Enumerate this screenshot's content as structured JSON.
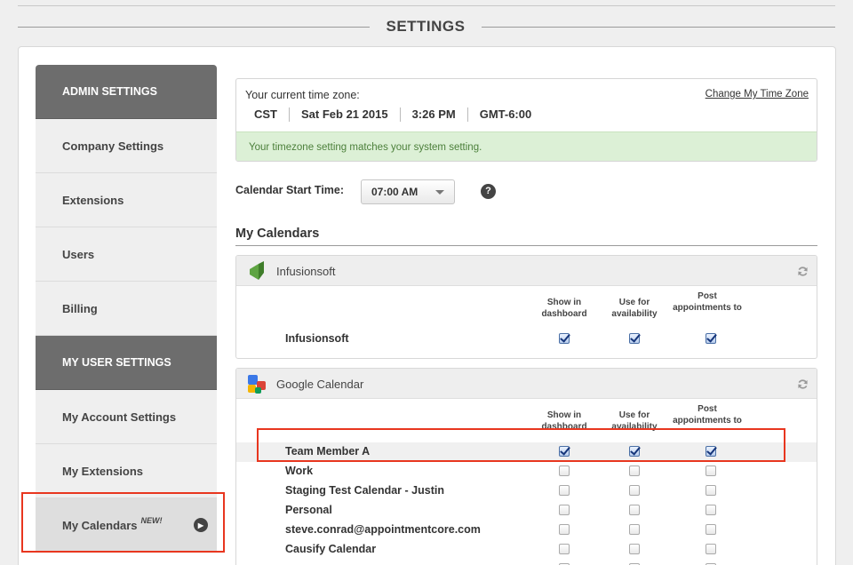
{
  "page": {
    "title": "SETTINGS"
  },
  "sidebar": {
    "items": [
      {
        "label": "ADMIN SETTINGS",
        "type": "header"
      },
      {
        "label": "Company Settings",
        "type": "link"
      },
      {
        "label": "Extensions",
        "type": "link"
      },
      {
        "label": "Users",
        "type": "link"
      },
      {
        "label": "Billing",
        "type": "link"
      },
      {
        "label": "MY USER SETTINGS",
        "type": "header"
      },
      {
        "label": "My Account Settings",
        "type": "link"
      },
      {
        "label": "My Extensions",
        "type": "link"
      },
      {
        "label": "My Calendars",
        "type": "link",
        "badge": "NEW!",
        "active": true
      }
    ]
  },
  "timezone": {
    "label": "Your current time zone:",
    "change_link": "Change My Time Zone",
    "zone": "CST",
    "date": "Sat Feb 21 2015",
    "time": "3:26 PM",
    "offset": "GMT-6:00",
    "status": "Your timezone setting matches your system setting."
  },
  "calendar_start": {
    "label": "Calendar Start Time:",
    "value": "07:00 AM",
    "help": "?"
  },
  "my_calendars": {
    "title": "My Calendars",
    "columns": [
      "Show in dashboard",
      "Use for availability",
      "Post appointments to"
    ],
    "groups": [
      {
        "name": "Infusionsoft",
        "icon": "infusionsoft-logo-icon",
        "rows": [
          {
            "name": "Infusionsoft",
            "checks": [
              true,
              true,
              true
            ]
          }
        ]
      },
      {
        "name": "Google Calendar",
        "icon": "google-calendar-logo-icon",
        "rows": [
          {
            "name": "Team Member A",
            "checks": [
              true,
              true,
              true
            ]
          },
          {
            "name": "Work",
            "checks": [
              false,
              false,
              false
            ]
          },
          {
            "name": "Staging Test Calendar - Justin",
            "checks": [
              false,
              false,
              false
            ]
          },
          {
            "name": "Personal",
            "checks": [
              false,
              false,
              false
            ]
          },
          {
            "name": "steve.conrad@appointmentcore.com",
            "checks": [
              false,
              false,
              false
            ]
          },
          {
            "name": "Causify Calendar",
            "checks": [
              false,
              false,
              false
            ]
          }
        ]
      }
    ]
  },
  "colors": {
    "sidebar_header": "#6d6d6d",
    "success_bg": "#dcf0d6",
    "success_text": "#4b7f3a",
    "annotation_red": "#e8361f"
  }
}
